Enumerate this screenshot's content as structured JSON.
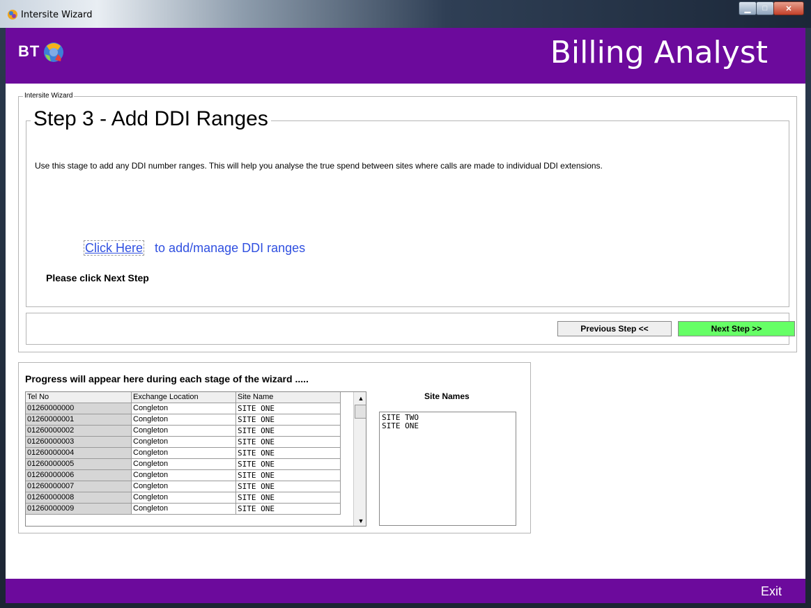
{
  "window": {
    "title": "Intersite Wizard"
  },
  "header": {
    "logo_text": "BT",
    "app_title": "Billing Analyst"
  },
  "wizard": {
    "group_label": "Intersite Wizard",
    "step_title": "Step 3 - Add DDI Ranges",
    "description": "Use this stage to add any DDI number ranges. This will help you analyse the true spend between sites where calls are made to individual DDI extensions.",
    "link_text": "Click Here",
    "link_suffix": "to add/manage DDI ranges",
    "instruction": "Please click Next Step",
    "prev_label": "Previous Step <<",
    "next_label": "Next Step >>"
  },
  "progress": {
    "title": "Progress will appear here during each stage of the wizard .....",
    "columns": [
      "Tel No",
      "Exchange Location",
      "Site Name"
    ],
    "rows": [
      [
        "01260000000",
        "Congleton",
        "SITE ONE"
      ],
      [
        "01260000001",
        "Congleton",
        "SITE ONE"
      ],
      [
        "01260000002",
        "Congleton",
        "SITE ONE"
      ],
      [
        "01260000003",
        "Congleton",
        "SITE ONE"
      ],
      [
        "01260000004",
        "Congleton",
        "SITE ONE"
      ],
      [
        "01260000005",
        "Congleton",
        "SITE ONE"
      ],
      [
        "01260000006",
        "Congleton",
        "SITE ONE"
      ],
      [
        "01260000007",
        "Congleton",
        "SITE ONE"
      ],
      [
        "01260000008",
        "Congleton",
        "SITE ONE"
      ],
      [
        "01260000009",
        "Congleton",
        "SITE ONE"
      ]
    ],
    "site_names_title": "Site Names",
    "site_names": [
      "SITE TWO",
      "SITE ONE"
    ]
  },
  "footer": {
    "exit_label": "Exit"
  },
  "colors": {
    "brand_purple": "#6c0a9c",
    "next_green": "#66ff66",
    "link_blue": "#3050e0"
  },
  "icons": {
    "app": "bt-globe-icon"
  }
}
